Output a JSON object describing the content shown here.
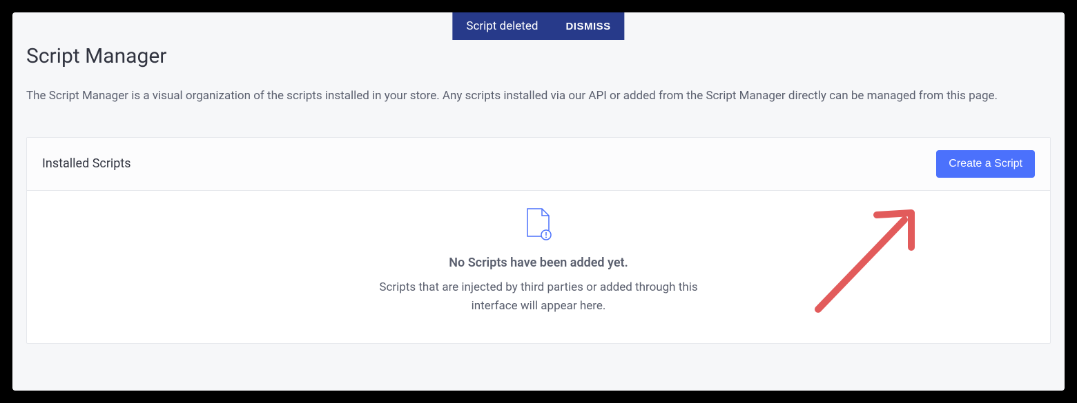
{
  "toast": {
    "message": "Script deleted",
    "dismiss_label": "DISMISS"
  },
  "page": {
    "title": "Script Manager",
    "description": "The Script Manager is a visual organization of the scripts installed in your store. Any scripts installed via our API or added from the Script Manager directly can be managed from this page."
  },
  "panel": {
    "title": "Installed Scripts",
    "create_button_label": "Create a Script",
    "empty_state": {
      "title": "No Scripts have been added yet.",
      "description": "Scripts that are injected by third parties or added through this interface will appear here."
    }
  }
}
